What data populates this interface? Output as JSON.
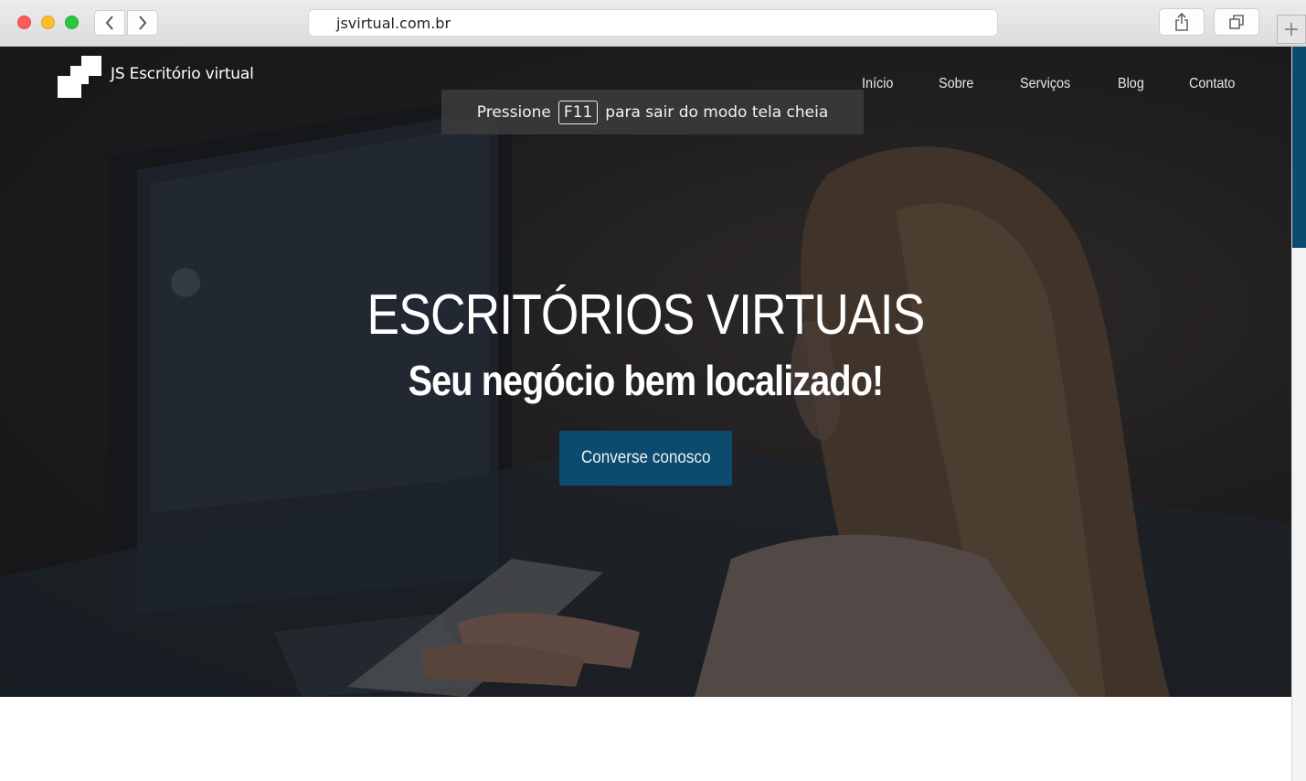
{
  "browser": {
    "url": "jsvirtual.com.br",
    "newtab_symbol": "+"
  },
  "site": {
    "logo_text": "JS Escritório virtual",
    "nav": [
      "Início",
      "Sobre",
      "Serviços",
      "Blog",
      "Contato"
    ]
  },
  "fullscreen_notice": {
    "before": "Pressione",
    "key": "F11",
    "after": "para sair do modo tela cheia"
  },
  "hero": {
    "title": "ESCRITÓRIOS VIRTUAIS",
    "subtitle": "Seu negócio bem localizado!",
    "cta_label": "Converse conosco"
  },
  "colors": {
    "accent": "#0c4a6e",
    "text_light": "#ffffff"
  },
  "icons": [
    "back-icon",
    "forward-icon",
    "share-icon",
    "tabs-icon",
    "plus-icon"
  ]
}
